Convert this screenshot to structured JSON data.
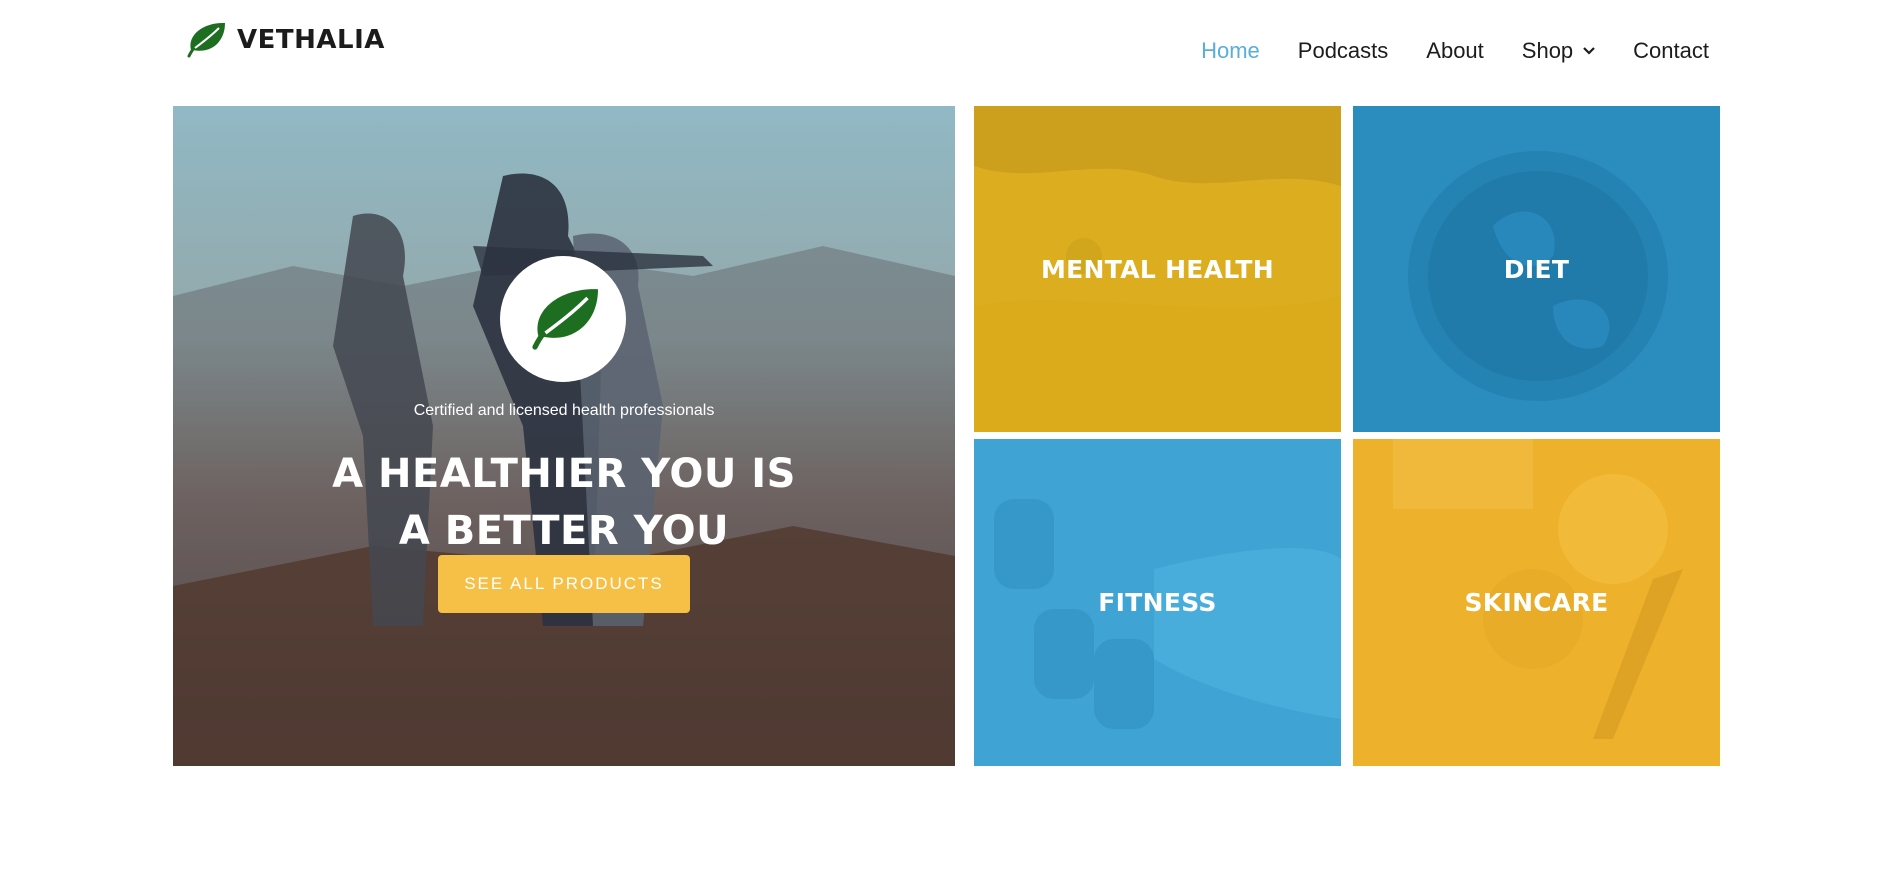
{
  "brand": {
    "name": "VETHALIA",
    "icon": "leaf-icon",
    "icon_color": "#1e6e22"
  },
  "nav": {
    "items": [
      {
        "label": "Home",
        "active": true
      },
      {
        "label": "Podcasts",
        "active": false
      },
      {
        "label": "About",
        "active": false
      },
      {
        "label": "Shop",
        "active": false,
        "dropdown": true
      },
      {
        "label": "Contact",
        "active": false
      }
    ],
    "active_color": "#5aaedb"
  },
  "hero": {
    "badge_icon": "leaf-icon",
    "subtitle": "Certified and licensed  health professionals",
    "title_line1": "A HEALTHIER YOU IS",
    "title_line2": "A BETTER YOU",
    "button_label": "SEE ALL PRODUCTS",
    "button_color": "#f6c046"
  },
  "tiles": [
    {
      "label": "MENTAL HEALTH",
      "color": "#dcae1f"
    },
    {
      "label": "DIET",
      "color": "#2b8dbe"
    },
    {
      "label": "FITNESS",
      "color": "#3fa3d4"
    },
    {
      "label": "SKINCARE",
      "color": "#edb12c"
    }
  ]
}
